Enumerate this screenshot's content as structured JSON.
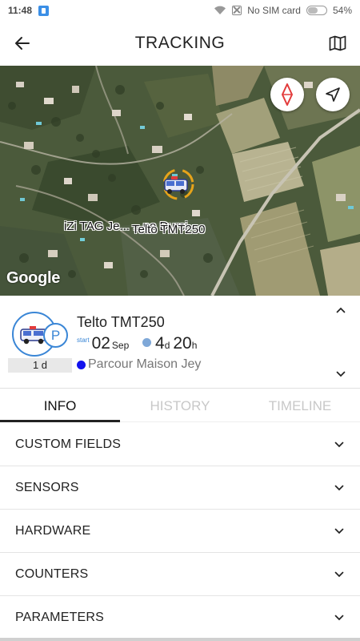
{
  "status_bar": {
    "time": "11:48",
    "carrier": "No SIM card",
    "battery": "54%",
    "battery_level": 0.54,
    "icons": [
      "app-notification-icon",
      "wifi-icon",
      "no-sim-icon",
      "battery-icon"
    ]
  },
  "header": {
    "title": "TRACKING",
    "back_icon": "arrow-left-icon",
    "map_icon": "map-icon"
  },
  "map": {
    "label_overlap_1": "iZi TAG Je... ...ne Durci",
    "label_primary": "Telto TMT250",
    "attribution": "Google",
    "compass_icon": "compass-icon",
    "locate_icon": "navigation-arrow-icon"
  },
  "device": {
    "name": "Telto TMT250",
    "status_icon": "parking-icon",
    "status_letter": "P",
    "duration_badge": "1 d",
    "start_caption": "start",
    "start_day": "02",
    "start_month": "Sep",
    "elapsed_days": "4",
    "elapsed_days_unit": "d",
    "elapsed_hours": "20",
    "elapsed_hours_unit": "h",
    "route_name": "Parcour Maison Jey",
    "route_color": "#1212ee",
    "accent_color": "#3a86d6"
  },
  "tabs": [
    {
      "label": "INFO",
      "active": true
    },
    {
      "label": "HISTORY",
      "active": false
    },
    {
      "label": "TIMELINE",
      "active": false
    }
  ],
  "sections": [
    {
      "label": "CUSTOM FIELDS"
    },
    {
      "label": "SENSORS"
    },
    {
      "label": "HARDWARE"
    },
    {
      "label": "COUNTERS"
    },
    {
      "label": "PARAMETERS"
    }
  ]
}
